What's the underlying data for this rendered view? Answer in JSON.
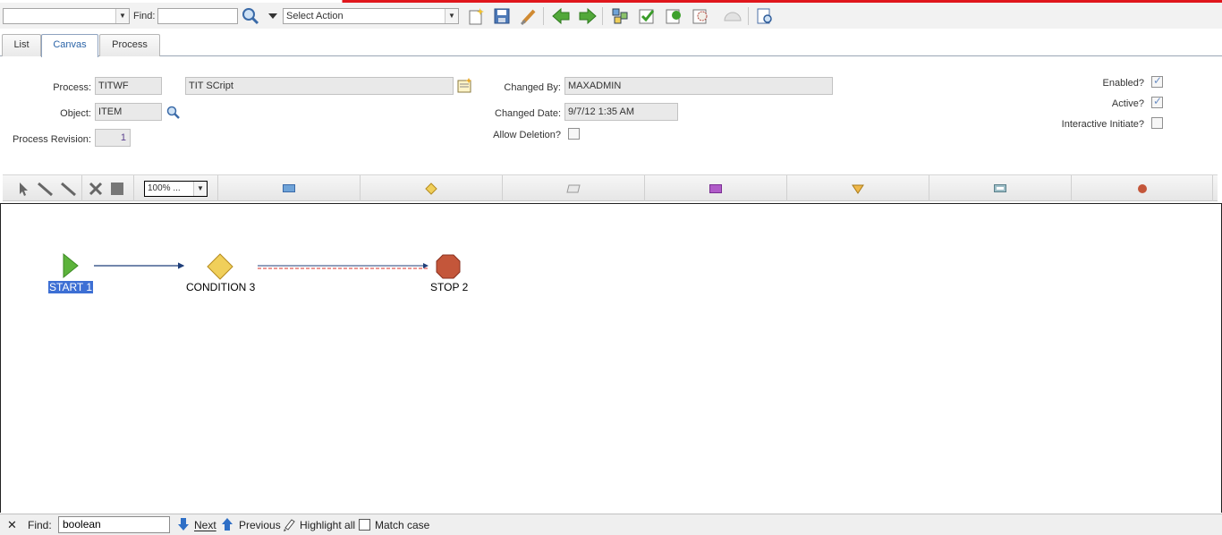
{
  "toolbar": {
    "app_select_value": "",
    "find_label": "Find:",
    "find_value": "",
    "action_select_value": "Select Action",
    "icons": [
      "new-record-icon",
      "save-icon",
      "clear-changes-icon",
      "previous-record-icon",
      "next-record-icon",
      "workflow-tree-icon",
      "validate-process-icon",
      "activate-process-icon",
      "enable-process-icon",
      "deactivate-process-icon",
      "view-assignments-icon"
    ]
  },
  "tabs": [
    {
      "label": "List"
    },
    {
      "label": "Canvas",
      "active": true
    },
    {
      "label": "Process"
    }
  ],
  "form": {
    "process_label": "Process:",
    "process_value": "TITWF",
    "process_desc": "TIT SCript",
    "object_label": "Object:",
    "object_value": "ITEM",
    "revision_label": "Process Revision:",
    "revision_value": "1",
    "changed_by_label": "Changed By:",
    "changed_by_value": "MAXADMIN",
    "changed_date_label": "Changed Date:",
    "changed_date_value": "9/7/12 1:35 AM",
    "allow_deletion_label": "Allow Deletion?",
    "allow_deletion": false,
    "enabled_label": "Enabled?",
    "enabled": true,
    "active_label": "Active?",
    "active": true,
    "interactive_label": "Interactive Initiate?",
    "interactive": false
  },
  "palette": {
    "zoom_value": "100%  ...",
    "tools": [
      "select-tool-icon",
      "positive-connector-icon",
      "negative-connector-icon",
      "delete-icon",
      "grid-icon"
    ],
    "nodes": [
      "task-node-icon",
      "condition-node-icon",
      "manual-input-node-icon",
      "subprocess-node-icon",
      "wait-node-icon",
      "interaction-node-icon",
      "stop-node-icon"
    ]
  },
  "canvas": {
    "nodes": [
      {
        "label": "START 1",
        "type": "start",
        "selected": true
      },
      {
        "label": "CONDITION 3",
        "type": "condition"
      },
      {
        "label": "STOP 2",
        "type": "stop"
      }
    ]
  },
  "findbar": {
    "find_label": "Find:",
    "find_value": "boolean",
    "next_label": "Next",
    "previous_label": "Previous",
    "highlight_label": "Highlight all",
    "match_label": "Match case"
  },
  "colors": {
    "accent_red": "#e0161c",
    "selection_blue": "#3d6fd4",
    "start_green": "#5cb33b",
    "condition_yellow": "#f0cf5a",
    "stop_red": "#c4563a"
  }
}
